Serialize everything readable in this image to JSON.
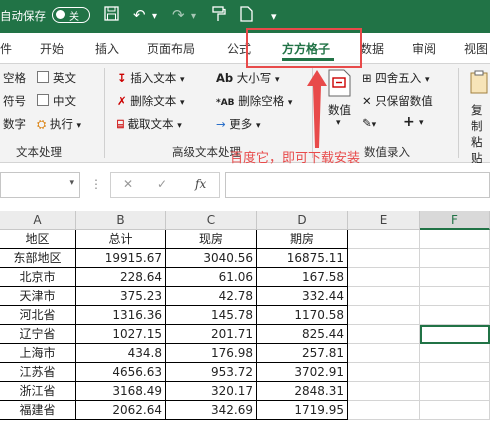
{
  "titlebar": {
    "autosave_label": "自动保存",
    "toggle_label": "关"
  },
  "tabs": [
    "件",
    "开始",
    "插入",
    "页面布局",
    "公式",
    "方方格子",
    "数据",
    "审阅",
    "视图"
  ],
  "active_tab": "方方格子",
  "ribbon": {
    "text_group": {
      "left_items": [
        "空格",
        "符号",
        "数字"
      ],
      "checks": [
        "英文",
        "中文"
      ],
      "exec_label": "执行",
      "group_label": "文本处理"
    },
    "advanced_group": {
      "items": [
        "插入文本",
        "删除文本",
        "截取文本"
      ],
      "items2": [
        "大小写",
        "删除空格",
        "更多"
      ],
      "group_label": "高级文本处理"
    },
    "number_group": {
      "numeric_label": "数值",
      "items": [
        "四舍五入",
        "只保留数值"
      ],
      "group_label": "数值录入"
    },
    "right_label": "复制粘贴"
  },
  "annotation": "百度它，即可下载安装",
  "formula_bar": {
    "fx_label": "fx",
    "cancel": "✕",
    "confirm": "✓"
  },
  "columns": [
    "A",
    "B",
    "C",
    "D",
    "E",
    "F"
  ],
  "table": {
    "headers": [
      "地区",
      "总计",
      "现房",
      "期房"
    ],
    "rows": [
      [
        "东部地区",
        "19915.67",
        "3040.56",
        "16875.11"
      ],
      [
        "北京市",
        "228.64",
        "61.06",
        "167.58"
      ],
      [
        "天津市",
        "375.23",
        "42.78",
        "332.44"
      ],
      [
        "河北省",
        "1316.36",
        "145.78",
        "1170.58"
      ],
      [
        "辽宁省",
        "1027.15",
        "201.71",
        "825.44"
      ],
      [
        "上海市",
        "434.8",
        "176.98",
        "257.81"
      ],
      [
        "江苏省",
        "4656.63",
        "953.72",
        "3702.91"
      ],
      [
        "浙江省",
        "3168.49",
        "320.17",
        "2848.31"
      ],
      [
        "福建省",
        "2062.64",
        "342.69",
        "1719.95"
      ]
    ]
  },
  "colors": {
    "excel_green": "#217346",
    "highlight_red": "#e84a4a"
  }
}
